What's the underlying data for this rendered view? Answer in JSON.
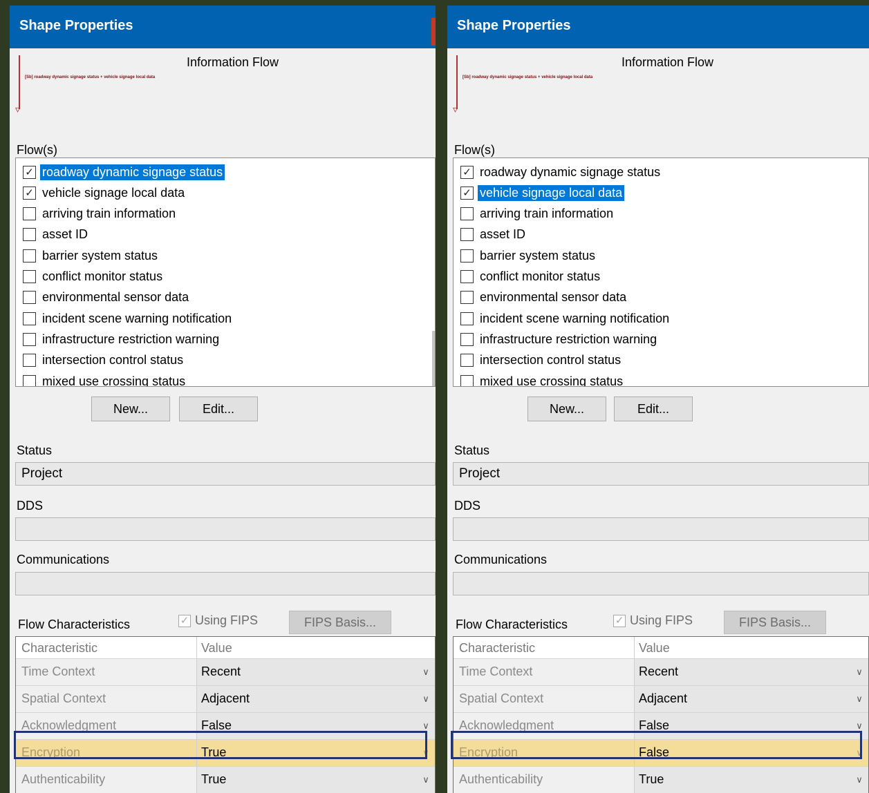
{
  "panels": {
    "left": {
      "title": "Shape Properties",
      "preview": {
        "title": "Information Flow",
        "label": "[Sb] roadway dynamic signage status + vehicle signage local data"
      },
      "flows_label": "Flow(s)",
      "flows": [
        {
          "label": "roadway dynamic signage status",
          "checked": true,
          "selected": true
        },
        {
          "label": "vehicle signage local data",
          "checked": true,
          "selected": false
        },
        {
          "label": "arriving train information",
          "checked": false,
          "selected": false
        },
        {
          "label": "asset ID",
          "checked": false,
          "selected": false
        },
        {
          "label": "barrier system status",
          "checked": false,
          "selected": false
        },
        {
          "label": "conflict monitor status",
          "checked": false,
          "selected": false
        },
        {
          "label": "environmental sensor data",
          "checked": false,
          "selected": false
        },
        {
          "label": "incident scene warning notification",
          "checked": false,
          "selected": false
        },
        {
          "label": "infrastructure restriction warning",
          "checked": false,
          "selected": false
        },
        {
          "label": "intersection control status",
          "checked": false,
          "selected": false
        },
        {
          "label": "mixed use crossing status",
          "checked": false,
          "selected": false
        }
      ],
      "new_button": "New...",
      "edit_button": "Edit...",
      "status_label": "Status",
      "status_value": "Project",
      "dds_label": "DDS",
      "dds_value": "",
      "communications_label": "Communications",
      "communications_value": "",
      "flow_characteristics_label": "Flow Characteristics",
      "using_fips_label": "Using FIPS",
      "using_fips_checked": true,
      "fips_basis_button": "FIPS Basis...",
      "grid_headers": {
        "characteristic": "Characteristic",
        "value": "Value"
      },
      "characteristics": [
        {
          "name": "Time Context",
          "value": "Recent",
          "highlighted": false
        },
        {
          "name": "Spatial Context",
          "value": "Adjacent",
          "highlighted": false
        },
        {
          "name": "Acknowledgment",
          "value": "False",
          "highlighted": false
        },
        {
          "name": "Encryption",
          "value": "True",
          "highlighted": true
        },
        {
          "name": "Authenticability",
          "value": "True",
          "highlighted": false
        }
      ]
    },
    "right": {
      "title": "Shape Properties",
      "preview": {
        "title": "Information Flow",
        "label": "[Sb] roadway dynamic signage status + vehicle signage local data"
      },
      "flows_label": "Flow(s)",
      "flows": [
        {
          "label": "roadway dynamic signage status",
          "checked": true,
          "selected": false
        },
        {
          "label": "vehicle signage local data",
          "checked": true,
          "selected": true
        },
        {
          "label": "arriving train information",
          "checked": false,
          "selected": false
        },
        {
          "label": "asset ID",
          "checked": false,
          "selected": false
        },
        {
          "label": "barrier system status",
          "checked": false,
          "selected": false
        },
        {
          "label": "conflict monitor status",
          "checked": false,
          "selected": false
        },
        {
          "label": "environmental sensor data",
          "checked": false,
          "selected": false
        },
        {
          "label": "incident scene warning notification",
          "checked": false,
          "selected": false
        },
        {
          "label": "infrastructure restriction warning",
          "checked": false,
          "selected": false
        },
        {
          "label": "intersection control status",
          "checked": false,
          "selected": false
        },
        {
          "label": "mixed use crossing status",
          "checked": false,
          "selected": false
        }
      ],
      "new_button": "New...",
      "edit_button": "Edit...",
      "status_label": "Status",
      "status_value": "Project",
      "dds_label": "DDS",
      "dds_value": "",
      "communications_label": "Communications",
      "communications_value": "",
      "flow_characteristics_label": "Flow Characteristics",
      "using_fips_label": "Using FIPS",
      "using_fips_checked": true,
      "fips_basis_button": "FIPS Basis...",
      "grid_headers": {
        "characteristic": "Characteristic",
        "value": "Value"
      },
      "characteristics": [
        {
          "name": "Time Context",
          "value": "Recent",
          "highlighted": false
        },
        {
          "name": "Spatial Context",
          "value": "Adjacent",
          "highlighted": false
        },
        {
          "name": "Acknowledgment",
          "value": "False",
          "highlighted": false
        },
        {
          "name": "Encryption",
          "value": "False",
          "highlighted": true
        },
        {
          "name": "Authenticability",
          "value": "True",
          "highlighted": false
        }
      ]
    }
  },
  "colors": {
    "title_bar": "#0062b1",
    "selection": "#0078d7",
    "row_highlight": "#f4dd9b",
    "highlight_border": "#1f3474"
  },
  "icons": {
    "checkbox_checked": "check-icon",
    "dropdown": "chevron-down-icon"
  }
}
